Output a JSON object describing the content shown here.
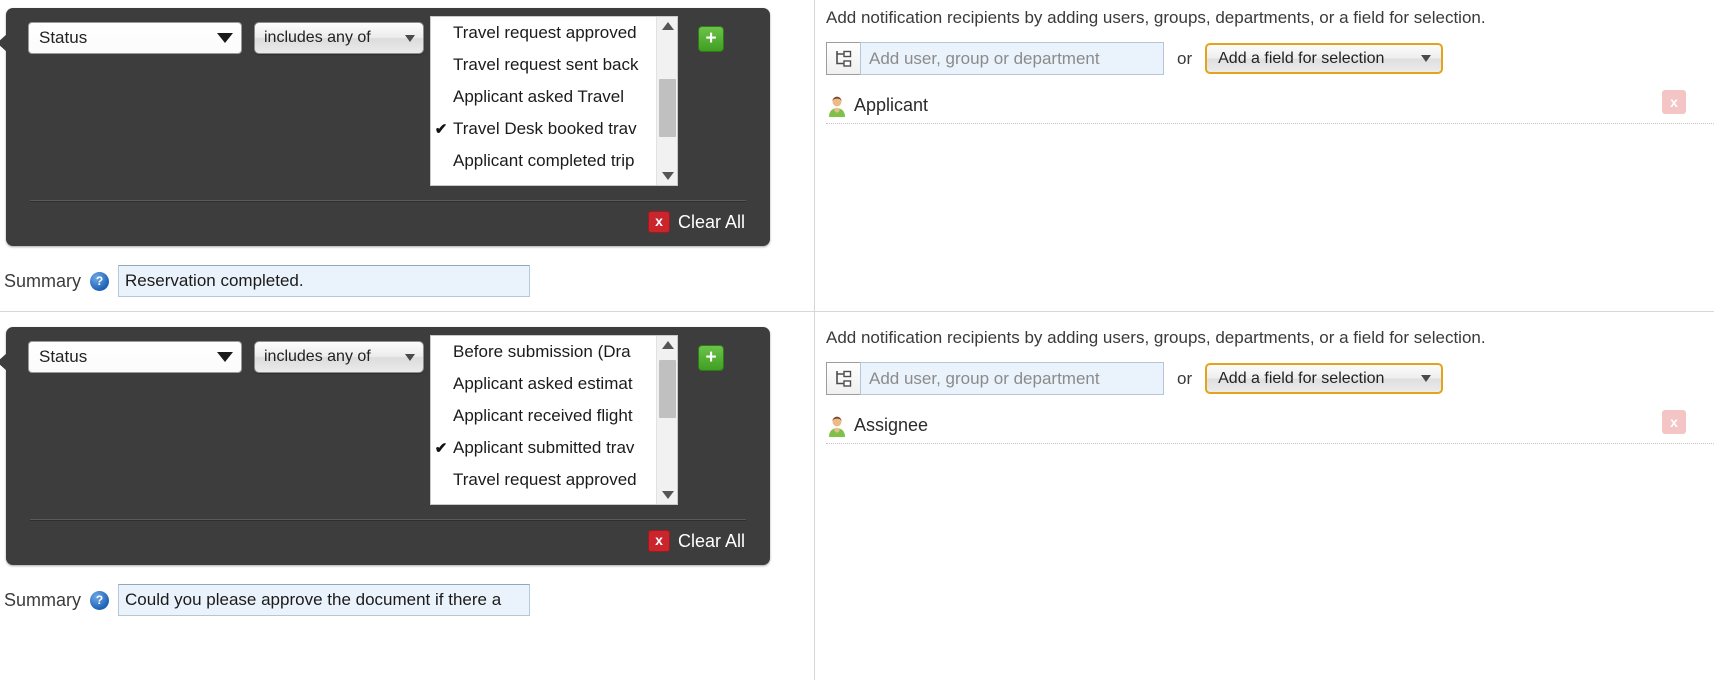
{
  "sections": [
    {
      "id": "section-1",
      "condition": {
        "field_select": {
          "value": "Status"
        },
        "operator_select": {
          "value": "includes any of"
        },
        "options": [
          {
            "label": "Travel request approved",
            "checked": false
          },
          {
            "label": "Travel request sent back",
            "checked": false
          },
          {
            "label": "Applicant asked Travel",
            "checked": false
          },
          {
            "label": "Travel Desk booked trav",
            "checked": true
          },
          {
            "label": "Applicant completed trip",
            "checked": false
          }
        ],
        "add_button_label": "+",
        "clear_all_label": "Clear All",
        "clear_all_icon": "x"
      },
      "summary": {
        "label": "Summary",
        "help_icon": "?",
        "value": "Reservation completed.",
        "placeholder": ""
      },
      "recipients_panel": {
        "description": "Add notification recipients by adding users, groups, departments, or a field for selection.",
        "tree_icon": "org-tree-icon",
        "input_placeholder": "Add user, group or department",
        "input_value": "",
        "or_label": "or",
        "field_select_label": "Add a field for selection",
        "recipients": [
          {
            "name": "Applicant",
            "avatar": "person-avatar",
            "delete_label": "x"
          }
        ]
      }
    },
    {
      "id": "section-2",
      "condition": {
        "field_select": {
          "value": "Status"
        },
        "operator_select": {
          "value": "includes any of"
        },
        "options": [
          {
            "label": "Before submission (Dra",
            "checked": false
          },
          {
            "label": "Applicant asked estimat",
            "checked": false
          },
          {
            "label": "Applicant received flight",
            "checked": false
          },
          {
            "label": "Applicant submitted trav",
            "checked": true
          },
          {
            "label": "Travel request approved",
            "checked": false
          }
        ],
        "add_button_label": "+",
        "clear_all_label": "Clear All",
        "clear_all_icon": "x"
      },
      "summary": {
        "label": "Summary",
        "help_icon": "?",
        "value": "Could you please approve the document if there a",
        "placeholder": ""
      },
      "recipients_panel": {
        "description": "Add notification recipients by adding users, groups, departments, or a field for selection.",
        "tree_icon": "org-tree-icon",
        "input_placeholder": "Add user, group or department",
        "input_value": "",
        "or_label": "or",
        "field_select_label": "Add a field for selection",
        "recipients": [
          {
            "name": "Assignee",
            "avatar": "person-avatar",
            "delete_label": "x"
          }
        ]
      }
    }
  ],
  "colors": {
    "panel_bg": "#3d3d3d",
    "accent_orange": "#e3a41c",
    "add_green": "#3f9f22",
    "clear_red": "#c9252d",
    "input_blue": "#eaf3fb"
  }
}
